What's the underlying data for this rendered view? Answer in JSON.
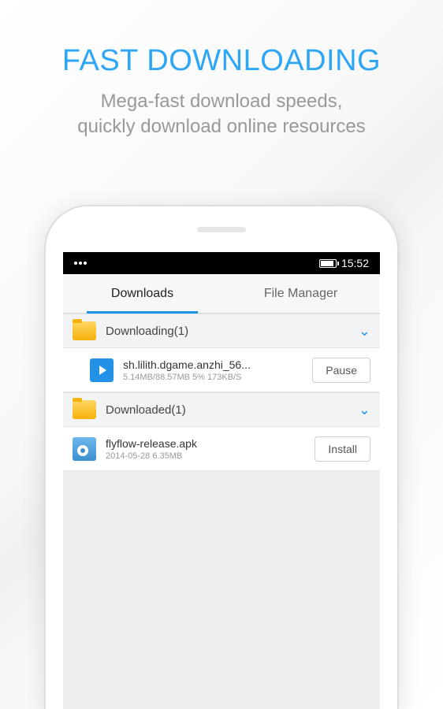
{
  "hero": {
    "title": "FAST DOWNLOADING",
    "subtitle_line1": "Mega-fast download speeds,",
    "subtitle_line2": "quickly download online resources"
  },
  "statusBar": {
    "time": "15:52"
  },
  "tabs": {
    "downloads": "Downloads",
    "fileManager": "File Manager"
  },
  "sections": {
    "downloading": {
      "label": "Downloading(1)"
    },
    "downloaded": {
      "label": "Downloaded(1)"
    }
  },
  "downloadingItem": {
    "title": "sh.lilith.dgame.anzhi_56...",
    "subtitle": "5.14MB/88.57MB 5% 173KB/S",
    "button": "Pause"
  },
  "downloadedItem": {
    "title": "flyflow-release.apk",
    "subtitle": "2014-05-28   6.35MB",
    "button": "Install"
  }
}
